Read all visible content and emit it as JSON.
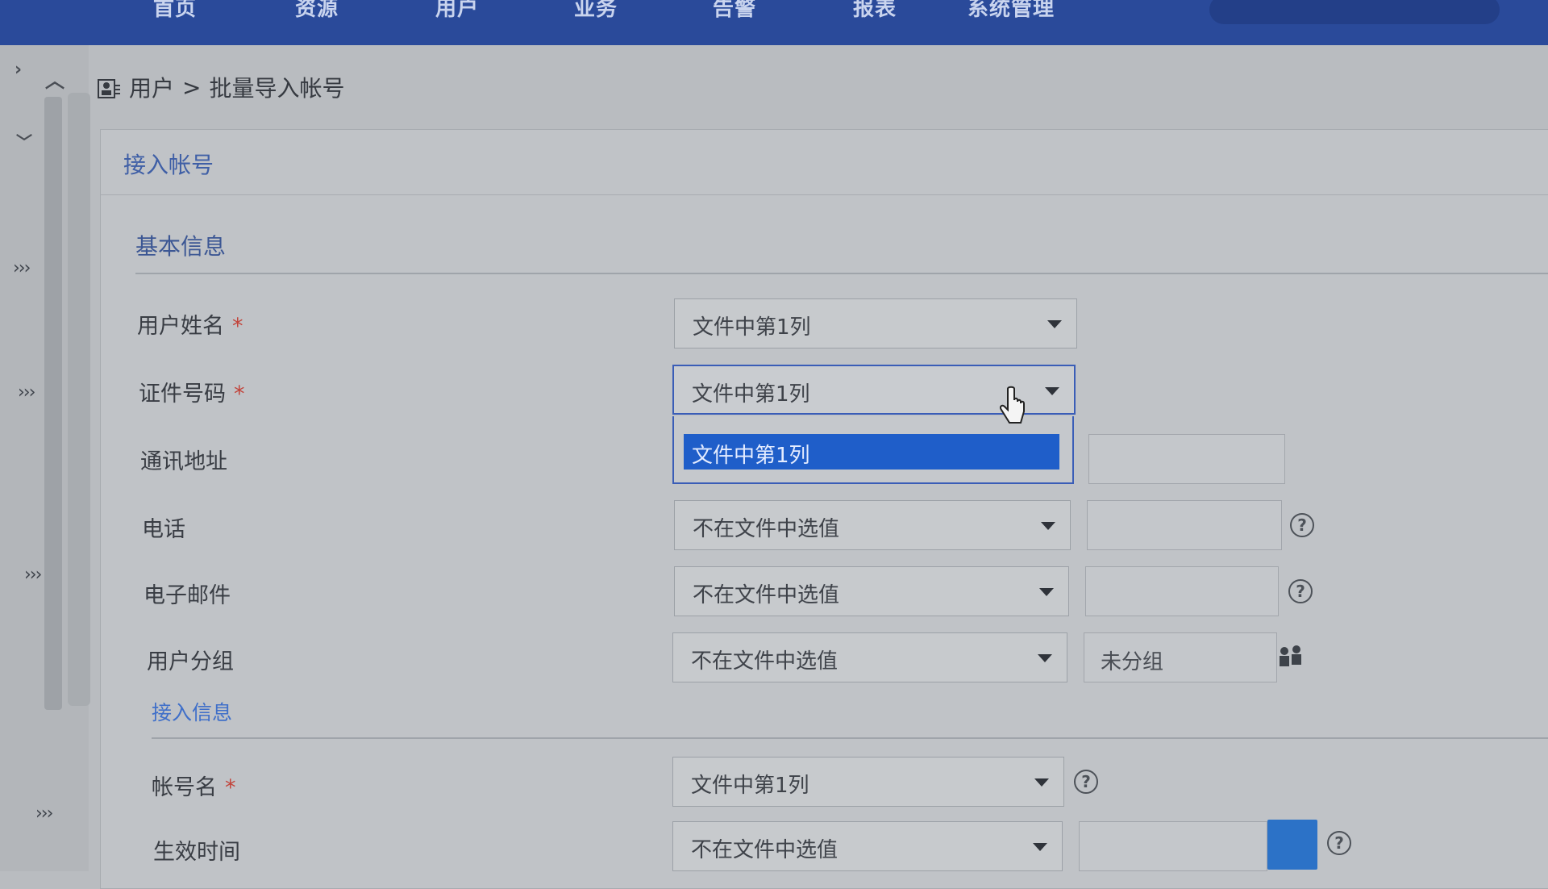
{
  "topnav": {
    "items": [
      "首页",
      "资源",
      "用户",
      "业务",
      "告警",
      "报表",
      "系统管理"
    ]
  },
  "breadcrumb": {
    "root": "用户",
    "separator": ">",
    "current": "批量导入帐号"
  },
  "panel": {
    "title": "接入帐号"
  },
  "basic_section": {
    "title": "基本信息",
    "fields": {
      "name": {
        "label": "用户姓名",
        "required": "*",
        "select_value": "文件中第1列"
      },
      "id_number": {
        "label": "证件号码",
        "required": "*",
        "select_value": "文件中第1列"
      },
      "address": {
        "label": "通讯地址"
      },
      "phone": {
        "label": "电话",
        "select_value": "不在文件中选值",
        "help": "?"
      },
      "email": {
        "label": "电子邮件",
        "select_value": "不在文件中选值",
        "help": "?"
      },
      "group": {
        "label": "用户分组",
        "select_value": "不在文件中选值",
        "text_value": "未分组"
      }
    },
    "dropdown_option": "文件中第1列"
  },
  "access_section": {
    "title": "接入信息",
    "fields": {
      "account_name": {
        "label": "帐号名",
        "required": "*",
        "select_value": "文件中第1列",
        "help": "?"
      },
      "effective_time": {
        "label": "生效时间",
        "select_value": "不在文件中选值",
        "help": "?"
      }
    }
  },
  "colors": {
    "topbar": "#2a4a9a",
    "accent": "#1f5ec9",
    "required": "#c2443b"
  }
}
